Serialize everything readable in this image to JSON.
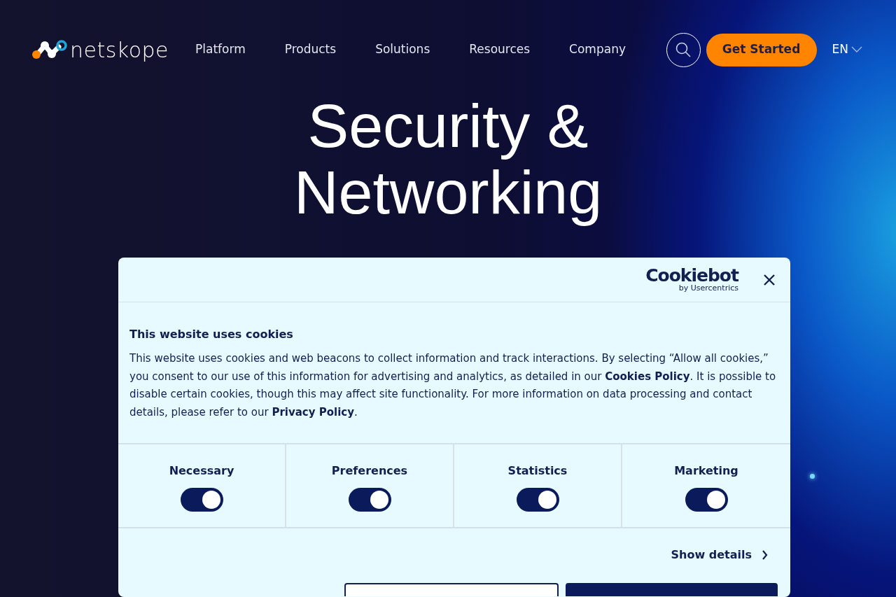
{
  "header": {
    "logo": "netskope",
    "nav": [
      "Platform",
      "Products",
      "Solutions",
      "Resources",
      "Company"
    ],
    "cta": "Get Started",
    "language": "EN"
  },
  "hero": {
    "lines": [
      "Security &",
      "Networking"
    ]
  },
  "cookie_dialog": {
    "brand": "Cookiebot",
    "brand_sub": "by Usercentrics",
    "title": "This website uses cookies",
    "body": "This website uses cookies and web beacons to collect information and track interactions. By selecting “Allow all cookies,” you consent to our use of this information for advertising and analytics, as detailed in our **Cookies Policy**. It is possible to disable certain cookies, though this may affect site functionality. For more information on data processing and contact details, please refer to our **Privacy Policy**.",
    "categories": [
      {
        "label": "Necessary",
        "on": true
      },
      {
        "label": "Preferences",
        "on": true
      },
      {
        "label": "Statistics",
        "on": true
      },
      {
        "label": "Marketing",
        "on": true
      }
    ],
    "details_link": "Show details"
  }
}
